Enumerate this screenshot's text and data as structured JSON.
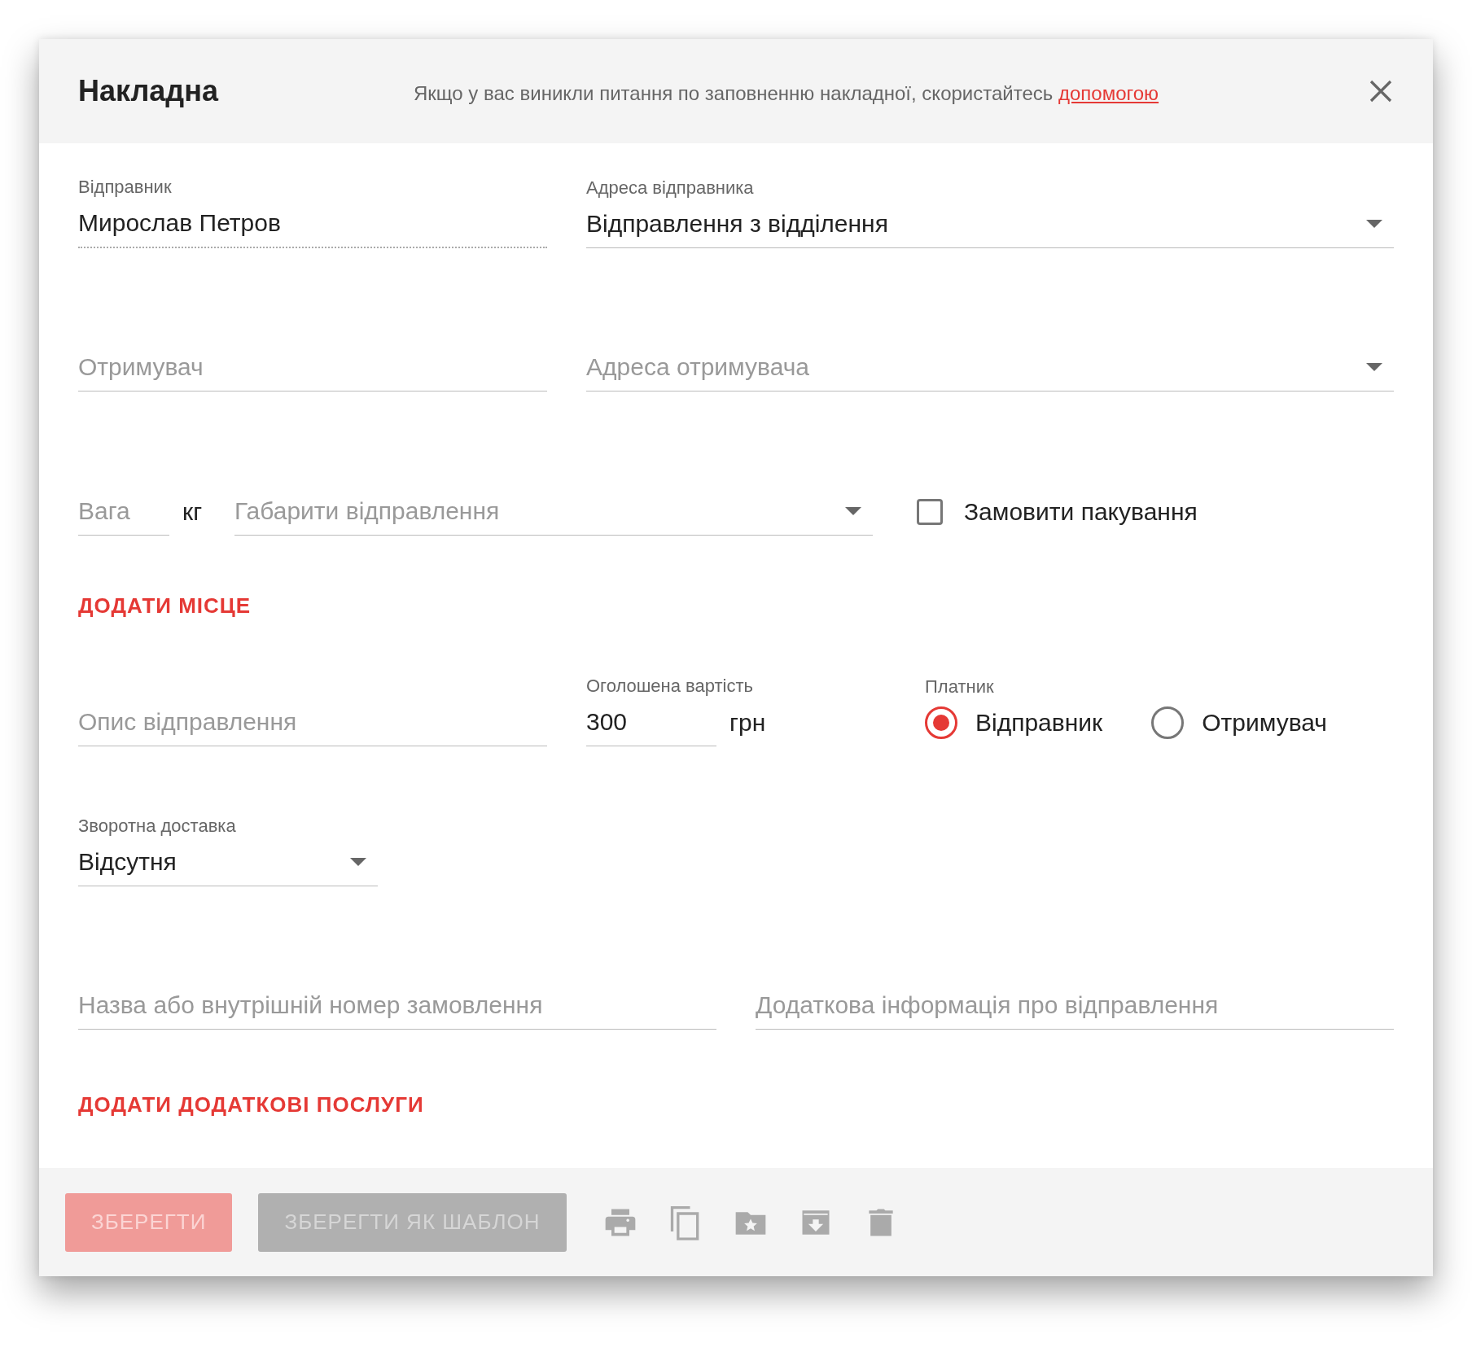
{
  "dialog": {
    "title": "Накладна",
    "help_text": "Якщо у вас виникли питання по заповненню накладної, скористайтесь",
    "help_link": "допомогою"
  },
  "sender": {
    "label": "Відправник",
    "value": "Мирослав Петров",
    "readonly": true
  },
  "sender_address": {
    "label": "Адреса відправника",
    "value": "Відправлення з відділення"
  },
  "recipient": {
    "placeholder": "Отримувач"
  },
  "recipient_address": {
    "placeholder": "Адреса отримувача"
  },
  "weight": {
    "placeholder": "Вага",
    "unit": "кг"
  },
  "dimensions": {
    "placeholder": "Габарити відправлення"
  },
  "packaging": {
    "label": "Замовити пакування",
    "checked": false
  },
  "add_place_link": "ДОДАТИ МІСЦЕ",
  "description": {
    "placeholder": "Опис відправлення"
  },
  "declared_value": {
    "label": "Оголошена вартість",
    "value": "300",
    "unit": "грн"
  },
  "payer": {
    "label": "Платник",
    "options": [
      {
        "label": "Відправник",
        "selected": true
      },
      {
        "label": "Отримувач",
        "selected": false
      }
    ]
  },
  "return_delivery": {
    "label": "Зворотна доставка",
    "value": "Відсутня"
  },
  "order_number": {
    "placeholder": "Назва або внутрішній номер замовлення"
  },
  "additional_info": {
    "placeholder": "Додаткова інформація про відправлення"
  },
  "add_services_link": "ДОДАТИ ДОДАТКОВІ ПОСЛУГИ",
  "buttons": [
    {
      "label": "ЗБЕРЕГТИ",
      "kind": "primary",
      "disabled": true
    },
    {
      "label": "ЗБЕРЕГТИ ЯК ШАБЛОН",
      "kind": "secondary",
      "disabled": true
    }
  ]
}
